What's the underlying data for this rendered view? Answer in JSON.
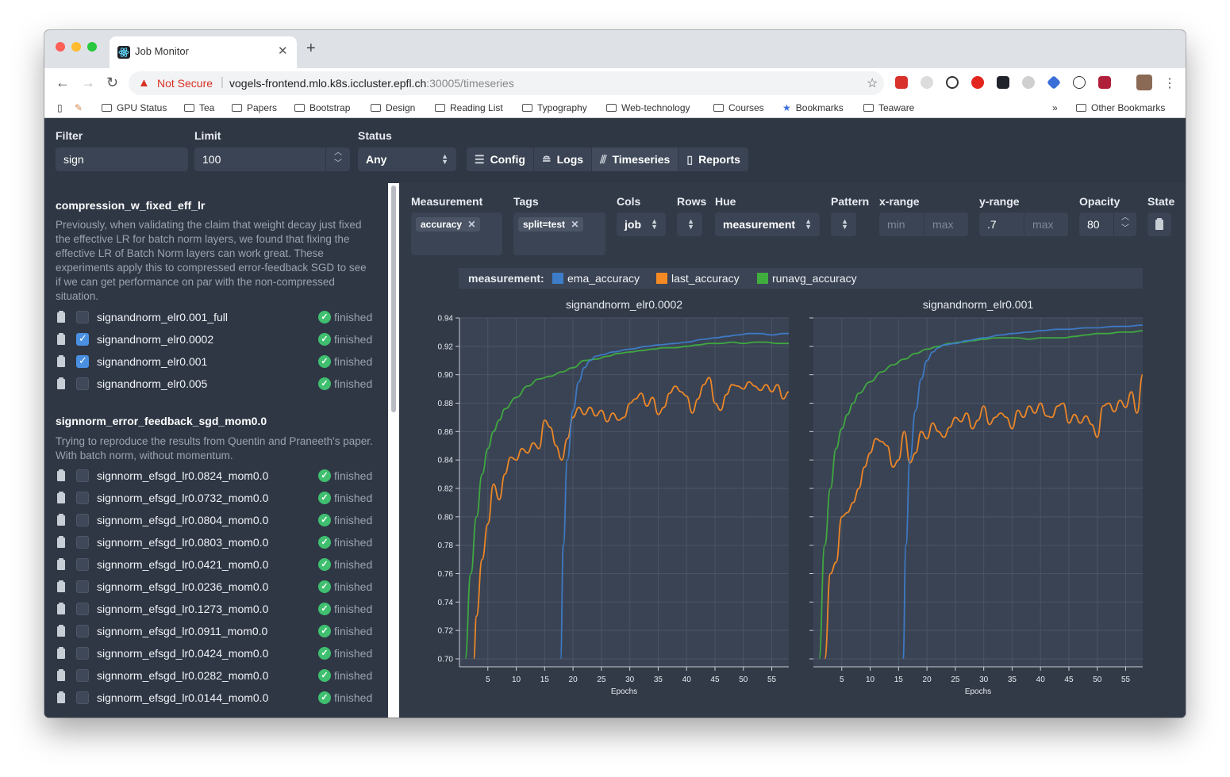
{
  "browser": {
    "tab_title": "Job Monitor",
    "security_label": "Not Secure",
    "url_host": "vogels-frontend.mlo.k8s.iccluster.epfl.ch",
    "url_tail": ":30005/timeseries",
    "bookmarks": [
      "GPU Status",
      "Tea",
      "Papers",
      "Bootstrap",
      "Design",
      "Reading List",
      "Typography",
      "Web-technology",
      "Courses",
      "Bookmarks",
      "Teaware"
    ],
    "other_bookmarks": "Other Bookmarks",
    "overflow": "»"
  },
  "filters": {
    "filter_label": "Filter",
    "filter_value": "sign",
    "limit_label": "Limit",
    "limit_value": "100",
    "status_label": "Status",
    "status_value": "Any"
  },
  "nav": {
    "config": "Config",
    "logs": "Logs",
    "timeseries": "Timeseries",
    "reports": "Reports"
  },
  "groups": [
    {
      "title": "compression_w_fixed_eff_lr",
      "description": "Previously, when validating the claim that weight decay just fixed the effective LR for batch norm layers, we found that fixing the effective LR of Batch Norm layers can work great. These experiments apply this to compressed error-feedback SGD to see if we can get performance on par with the non-compressed situation.",
      "jobs": [
        {
          "name": "signandnorm_elr0.001_full",
          "status": "finished",
          "checked": false
        },
        {
          "name": "signandnorm_elr0.0002",
          "status": "finished",
          "checked": true
        },
        {
          "name": "signandnorm_elr0.001",
          "status": "finished",
          "checked": true
        },
        {
          "name": "signandnorm_elr0.005",
          "status": "finished",
          "checked": false
        }
      ]
    },
    {
      "title": "signnorm_error_feedback_sgd_mom0.0",
      "description": "Trying to reproduce the results from Quentin and Praneeth's paper. With batch norm, without momentum.",
      "jobs": [
        {
          "name": "signnorm_efsgd_lr0.0824_mom0.0",
          "status": "finished",
          "checked": false
        },
        {
          "name": "signnorm_efsgd_lr0.0732_mom0.0",
          "status": "finished",
          "checked": false
        },
        {
          "name": "signnorm_efsgd_lr0.0804_mom0.0",
          "status": "finished",
          "checked": false
        },
        {
          "name": "signnorm_efsgd_lr0.0803_mom0.0",
          "status": "finished",
          "checked": false
        },
        {
          "name": "signnorm_efsgd_lr0.0421_mom0.0",
          "status": "finished",
          "checked": false
        },
        {
          "name": "signnorm_efsgd_lr0.0236_mom0.0",
          "status": "finished",
          "checked": false
        },
        {
          "name": "signnorm_efsgd_lr0.1273_mom0.0",
          "status": "finished",
          "checked": false
        },
        {
          "name": "signnorm_efsgd_lr0.0911_mom0.0",
          "status": "finished",
          "checked": false
        },
        {
          "name": "signnorm_efsgd_lr0.0424_mom0.0",
          "status": "finished",
          "checked": false
        },
        {
          "name": "signnorm_efsgd_lr0.0282_mom0.0",
          "status": "finished",
          "checked": false
        },
        {
          "name": "signnorm_efsgd_lr0.0144_mom0.0",
          "status": "finished",
          "checked": false
        }
      ]
    }
  ],
  "controls": {
    "measurement_label": "Measurement",
    "measurement_chip": "accuracy",
    "tags_label": "Tags",
    "tags_chip": "split=test",
    "cols_label": "Cols",
    "cols_value": "job",
    "rows_label": "Rows",
    "hue_label": "Hue",
    "hue_value": "measurement",
    "pattern_label": "Pattern",
    "xrange_label": "x-range",
    "xrange_min_placeholder": "min",
    "xrange_max_placeholder": "max",
    "yrange_label": "y-range",
    "yrange_min_value": ".7",
    "yrange_max_placeholder": "max",
    "opacity_label": "Opacity",
    "opacity_value": "80",
    "state_label": "State"
  },
  "legend": {
    "title": "measurement:",
    "items": [
      {
        "name": "ema_accuracy",
        "color": "#3d7cc9"
      },
      {
        "name": "last_accuracy",
        "color": "#f58a25"
      },
      {
        "name": "runavg_accuracy",
        "color": "#3fae3f"
      }
    ]
  },
  "chart_data": [
    {
      "type": "line",
      "title": "signandnorm_elr0.0002",
      "xlabel": "Epochs",
      "ylabel": "",
      "xlim": [
        0,
        58
      ],
      "ylim": [
        0.7,
        0.94
      ],
      "xticks": [
        5,
        10,
        15,
        20,
        25,
        30,
        35,
        40,
        45,
        50,
        55
      ],
      "yticks": [
        0.7,
        0.72,
        0.74,
        0.76,
        0.78,
        0.8,
        0.82,
        0.84,
        0.86,
        0.88,
        0.9,
        0.92,
        0.94
      ],
      "grid": true,
      "series": [
        {
          "name": "ema_accuracy",
          "color": "#3d7cc9",
          "x": [
            17.8,
            18.3,
            19,
            20,
            21,
            22,
            23,
            24,
            25,
            27,
            30,
            33,
            35,
            38,
            40,
            43,
            45,
            47,
            49,
            51,
            53,
            55,
            57,
            58
          ],
          "y": [
            0.7,
            0.78,
            0.84,
            0.875,
            0.895,
            0.905,
            0.91,
            0.913,
            0.914,
            0.916,
            0.918,
            0.92,
            0.921,
            0.922,
            0.923,
            0.925,
            0.926,
            0.927,
            0.928,
            0.929,
            0.929,
            0.928,
            0.929,
            0.929
          ]
        },
        {
          "name": "last_accuracy",
          "color": "#f58a25",
          "x": [
            2.5,
            3,
            4,
            5,
            6,
            7,
            8,
            9,
            10,
            11,
            12,
            13,
            14,
            15,
            16,
            17,
            18,
            19,
            20,
            21,
            22,
            23,
            24,
            25,
            26,
            27,
            28,
            29,
            30,
            31,
            32,
            33,
            34,
            35,
            36,
            37,
            38,
            39,
            40,
            41,
            42,
            43,
            44,
            45,
            46,
            47,
            48,
            49,
            50,
            51,
            52,
            53,
            54,
            55,
            56,
            57,
            58
          ],
          "y": [
            0.7,
            0.73,
            0.77,
            0.795,
            0.823,
            0.812,
            0.83,
            0.842,
            0.84,
            0.848,
            0.845,
            0.852,
            0.848,
            0.868,
            0.863,
            0.85,
            0.84,
            0.855,
            0.87,
            0.877,
            0.872,
            0.877,
            0.871,
            0.875,
            0.867,
            0.873,
            0.868,
            0.87,
            0.88,
            0.883,
            0.887,
            0.878,
            0.884,
            0.872,
            0.877,
            0.887,
            0.892,
            0.888,
            0.885,
            0.873,
            0.883,
            0.893,
            0.898,
            0.88,
            0.875,
            0.886,
            0.893,
            0.892,
            0.89,
            0.895,
            0.892,
            0.889,
            0.893,
            0.888,
            0.893,
            0.883,
            0.888
          ]
        },
        {
          "name": "runavg_accuracy",
          "color": "#3fae3f",
          "x": [
            1,
            2,
            3,
            4,
            5,
            6,
            7,
            8,
            10,
            12,
            14,
            16,
            18,
            20,
            22,
            24,
            26,
            28,
            30,
            32,
            34,
            36,
            38,
            40,
            42,
            44,
            46,
            48,
            50,
            52,
            54,
            56,
            58
          ],
          "y": [
            0.7,
            0.76,
            0.8,
            0.83,
            0.848,
            0.86,
            0.868,
            0.876,
            0.884,
            0.892,
            0.897,
            0.899,
            0.902,
            0.905,
            0.91,
            0.911,
            0.913,
            0.915,
            0.916,
            0.917,
            0.918,
            0.919,
            0.919,
            0.92,
            0.921,
            0.922,
            0.922,
            0.923,
            0.922,
            0.923,
            0.923,
            0.922,
            0.922
          ]
        }
      ]
    },
    {
      "type": "line",
      "title": "signandnorm_elr0.001",
      "xlabel": "Epochs",
      "ylabel": "",
      "xlim": [
        0,
        58
      ],
      "ylim": [
        0.7,
        0.94
      ],
      "xticks": [
        5,
        10,
        15,
        20,
        25,
        30,
        35,
        40,
        45,
        50,
        55
      ],
      "yticks": [
        0.7,
        0.72,
        0.74,
        0.76,
        0.78,
        0.8,
        0.82,
        0.84,
        0.86,
        0.88,
        0.9,
        0.92,
        0.94
      ],
      "grid": true,
      "series": [
        {
          "name": "ema_accuracy",
          "color": "#3d7cc9",
          "x": [
            15.8,
            16.3,
            17,
            18,
            19,
            20,
            21,
            22,
            23,
            25,
            27,
            30,
            33,
            35,
            38,
            40,
            43,
            45,
            48,
            50,
            53,
            55,
            58
          ],
          "y": [
            0.7,
            0.78,
            0.84,
            0.875,
            0.897,
            0.91,
            0.916,
            0.919,
            0.921,
            0.922,
            0.924,
            0.926,
            0.928,
            0.929,
            0.93,
            0.931,
            0.932,
            0.932,
            0.933,
            0.933,
            0.934,
            0.934,
            0.935
          ]
        },
        {
          "name": "last_accuracy",
          "color": "#f58a25",
          "x": [
            2,
            3,
            4,
            5,
            6,
            7,
            8,
            9,
            10,
            11,
            12,
            13,
            14,
            15,
            16,
            17,
            18,
            19,
            20,
            21,
            22,
            23,
            24,
            25,
            26,
            27,
            28,
            29,
            30,
            31,
            32,
            33,
            34,
            35,
            36,
            37,
            38,
            39,
            40,
            41,
            42,
            43,
            44,
            45,
            46,
            47,
            48,
            49,
            50,
            51,
            52,
            53,
            54,
            55,
            56,
            57,
            58
          ],
          "y": [
            0.7,
            0.76,
            0.768,
            0.8,
            0.803,
            0.81,
            0.82,
            0.835,
            0.845,
            0.855,
            0.853,
            0.85,
            0.835,
            0.84,
            0.86,
            0.838,
            0.845,
            0.86,
            0.855,
            0.866,
            0.86,
            0.856,
            0.863,
            0.87,
            0.867,
            0.873,
            0.862,
            0.868,
            0.878,
            0.865,
            0.87,
            0.873,
            0.87,
            0.862,
            0.875,
            0.87,
            0.878,
            0.873,
            0.88,
            0.871,
            0.87,
            0.878,
            0.88,
            0.866,
            0.872,
            0.866,
            0.871,
            0.865,
            0.856,
            0.878,
            0.88,
            0.874,
            0.882,
            0.877,
            0.888,
            0.873,
            0.9
          ]
        },
        {
          "name": "runavg_accuracy",
          "color": "#3fae3f",
          "x": [
            1,
            2,
            3,
            4,
            5,
            6,
            7,
            8,
            10,
            12,
            14,
            16,
            18,
            20,
            22,
            24,
            26,
            28,
            30,
            32,
            34,
            36,
            38,
            40,
            42,
            44,
            46,
            48,
            50,
            52,
            54,
            56,
            58
          ],
          "y": [
            0.7,
            0.78,
            0.82,
            0.848,
            0.862,
            0.872,
            0.88,
            0.887,
            0.895,
            0.902,
            0.907,
            0.911,
            0.915,
            0.918,
            0.92,
            0.922,
            0.923,
            0.924,
            0.925,
            0.926,
            0.926,
            0.926,
            0.925,
            0.926,
            0.926,
            0.926,
            0.927,
            0.928,
            0.929,
            0.929,
            0.93,
            0.93,
            0.931
          ]
        }
      ]
    }
  ]
}
